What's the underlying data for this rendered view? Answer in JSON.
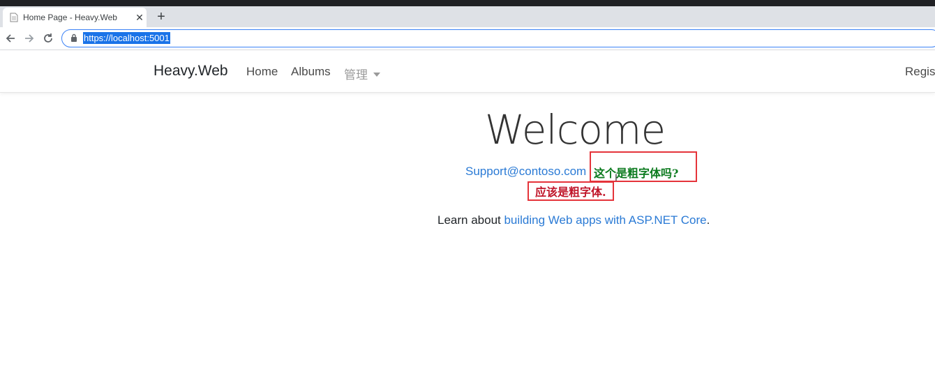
{
  "browser": {
    "tab_title": "Home Page - Heavy.Web",
    "close_glyph": "✕",
    "newtab_glyph": "+",
    "url": "https://localhost:5001"
  },
  "navbar": {
    "brand": "Heavy.Web",
    "links": [
      "Home",
      "Albums",
      "管理"
    ],
    "register": "Regist"
  },
  "main": {
    "welcome": "Welcome",
    "support_email": "Support@contoso.com",
    "annotation_question": "这个是粗字体吗?",
    "annotation_answer": "应该是粗字体.",
    "learn_prefix": "Learn about ",
    "learn_link": "building Web apps with ASP.NET Core",
    "learn_suffix": "."
  },
  "colors": {
    "link": "#2a7ad5",
    "annotation_green": "#0b7a1e",
    "annotation_red": "#c0162a",
    "box_border": "#e5343a",
    "url_highlight": "#1a73e8"
  },
  "icons": [
    "page-favicon-icon",
    "close-icon",
    "plus-icon",
    "back-arrow-icon",
    "forward-arrow-icon",
    "reload-icon",
    "lock-icon",
    "caret-down-icon"
  ]
}
